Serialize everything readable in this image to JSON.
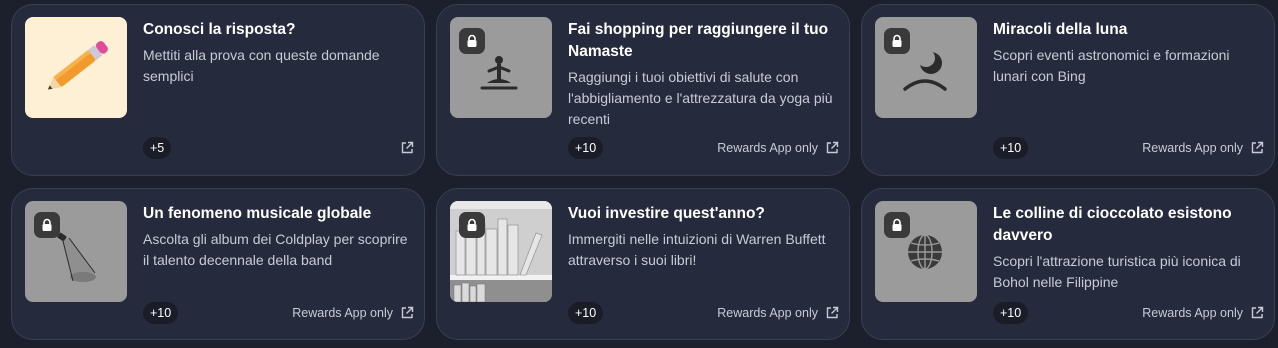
{
  "cards": [
    {
      "title": "Conosci la risposta?",
      "desc": "Mettiti alla prova con queste domande semplici",
      "points": "+5",
      "rewards": "",
      "thumb_icon": "pencil-icon",
      "locked": false
    },
    {
      "title": "Fai shopping per raggiungere il tuo Namaste",
      "desc": "Raggiungi i tuoi obiettivi di salute con l'abbigliamento e l'attrezzatura da yoga più recenti",
      "points": "+10",
      "rewards": "Rewards App only",
      "thumb_icon": "yoga-icon",
      "locked": true
    },
    {
      "title": "Miracoli della luna",
      "desc": "Scopri eventi astronomici e formazioni lunari con Bing",
      "points": "+10",
      "rewards": "Rewards App only",
      "thumb_icon": "moon-icon",
      "locked": true
    },
    {
      "title": "Un fenomeno musicale globale",
      "desc": "Ascolta gli album dei Coldplay per scoprire il talento decennale della band",
      "points": "+10",
      "rewards": "Rewards App only",
      "thumb_icon": "spotlight-icon",
      "locked": true
    },
    {
      "title": "Vuoi investire quest'anno?",
      "desc": "Immergiti nelle intuizioni di Warren Buffett attraverso i suoi libri!",
      "points": "+10",
      "rewards": "Rewards App only",
      "thumb_icon": "bookshelf-image",
      "locked": true
    },
    {
      "title": "Le colline di cioccolato esistono davvero",
      "desc": "Scopri l'attrazione turistica più iconica di Bohol nelle Filippine",
      "points": "+10",
      "rewards": "Rewards App only",
      "thumb_icon": "globe-icon",
      "locked": true
    }
  ]
}
